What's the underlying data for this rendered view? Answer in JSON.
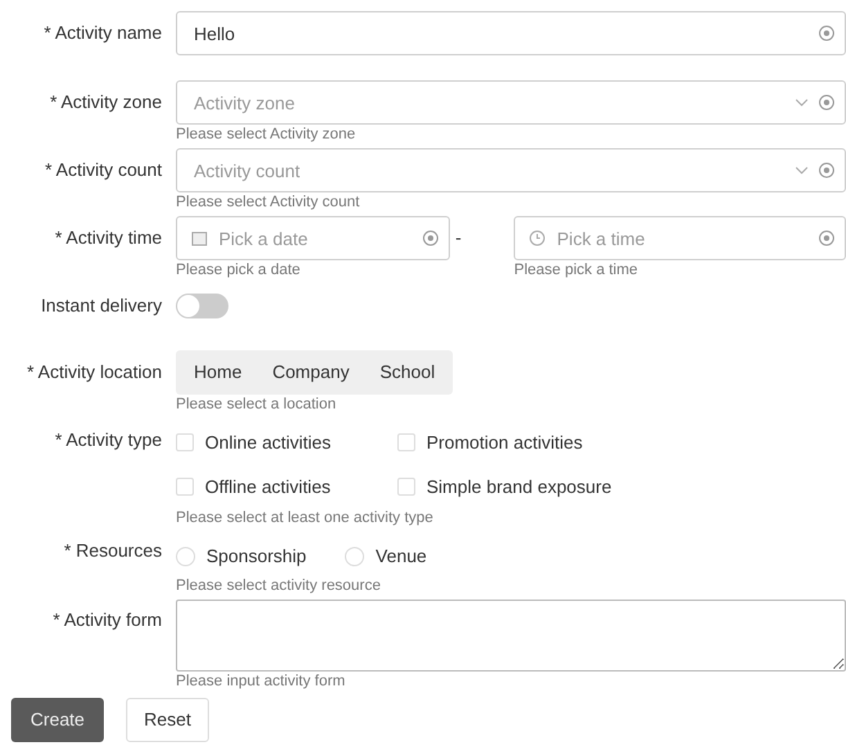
{
  "fields": [
    {
      "kind": "input",
      "label": "* Activity name",
      "value": "Hello"
    },
    {
      "kind": "select",
      "label": "* Activity zone",
      "placeholder": "Activity zone",
      "help": "Please select Activity zone"
    },
    {
      "kind": "select",
      "label": "* Activity count",
      "placeholder": "Activity count",
      "help": "Please select Activity count"
    },
    {
      "kind": "datetime",
      "label": "* Activity time",
      "date_placeholder": "Pick a date",
      "separator": "-",
      "time_placeholder": "Pick a time",
      "date_help": "Please pick a date",
      "time_help": "Please pick a time"
    },
    {
      "kind": "switch",
      "label": "Instant delivery",
      "on": false
    },
    {
      "kind": "segmented",
      "label": "* Activity location",
      "options": [
        {
          "label": "Home",
          "selected": false
        },
        {
          "label": "Company",
          "selected": false
        },
        {
          "label": "School",
          "selected": false
        }
      ],
      "help": "Please select a location"
    },
    {
      "kind": "checkboxes",
      "label": "* Activity type",
      "options": [
        {
          "label": "Online activities",
          "checked": false
        },
        {
          "label": "Promotion activities",
          "checked": false
        },
        {
          "label": "Offline activities",
          "checked": false
        },
        {
          "label": "Simple brand exposure",
          "checked": false
        }
      ],
      "help": "Please select at least one activity type"
    },
    {
      "kind": "radios",
      "label": "* Resources",
      "options": [
        {
          "label": "Sponsorship",
          "selected": false
        },
        {
          "label": "Venue",
          "selected": false
        }
      ],
      "help": "Please select activity resource"
    },
    {
      "kind": "textarea",
      "label": "* Activity form",
      "help": "Please input activity form"
    }
  ],
  "buttons": [
    {
      "label": "Create",
      "kind": "primary"
    },
    {
      "label": "Reset",
      "kind": "default"
    }
  ]
}
